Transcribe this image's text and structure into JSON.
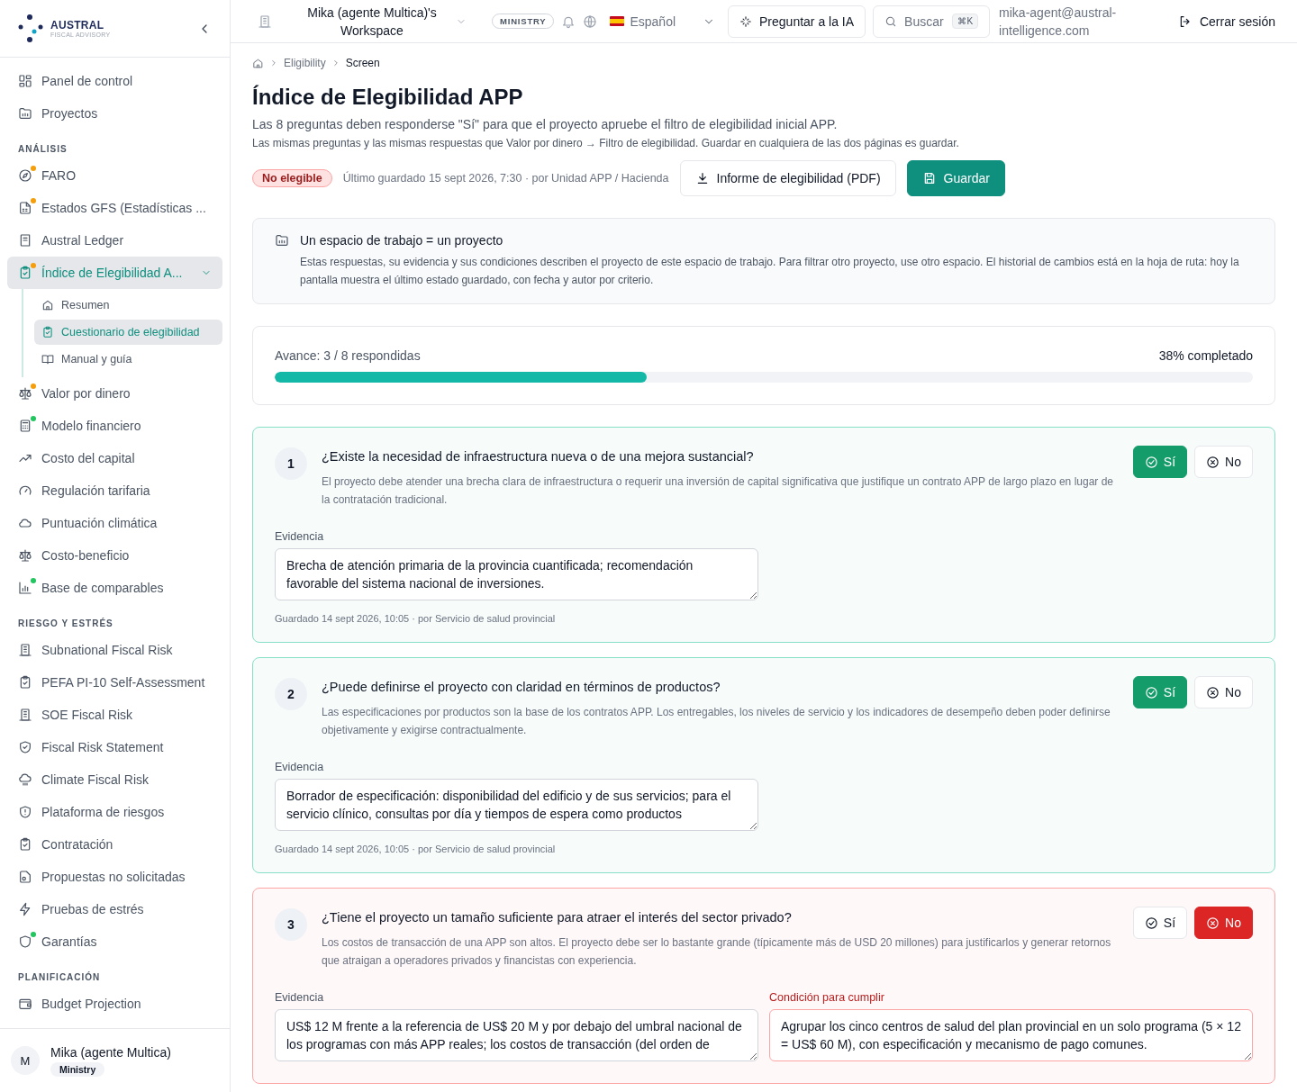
{
  "sidebar": {
    "logo": {
      "name": "AUSTRAL",
      "tagline": "FISCAL ADVISORY"
    },
    "groups": [
      {
        "items": [
          {
            "label": "Panel de control",
            "selected": false
          },
          {
            "label": "Proyectos",
            "selected": false
          }
        ]
      },
      {
        "heading": "ANÁLISIS",
        "items": [
          {
            "label": "FARO",
            "selected": false,
            "color": "#f59e0b"
          },
          {
            "label": "Estados GFS (Estadísticas ...",
            "selected": false,
            "color": "#f59e0b"
          },
          {
            "label": "Austral Ledger",
            "selected": false
          },
          {
            "label": "Índice de Elegibilidad A...",
            "selected": true,
            "expanded": true,
            "color": "#f59e0b",
            "children": [
              {
                "label": "Resumen",
                "selected": false
              },
              {
                "label": "Cuestionario de elegibilidad",
                "selected": true
              },
              {
                "label": "Manual y guía",
                "selected": false
              }
            ]
          },
          {
            "label": "Valor por dinero",
            "selected": false,
            "color": "#f59e0b"
          },
          {
            "label": "Modelo financiero",
            "selected": false,
            "color": "#22c55e"
          },
          {
            "label": "Costo del capital",
            "selected": false
          },
          {
            "label": "Regulación tarifaria",
            "selected": false
          },
          {
            "label": "Puntuación climática",
            "selected": false
          },
          {
            "label": "Costo-beneficio",
            "selected": false
          },
          {
            "label": "Base de comparables",
            "selected": false,
            "color": "#22c55e"
          }
        ]
      },
      {
        "heading": "RIESGO Y ESTRÉS",
        "items": [
          {
            "label": "Subnational Fiscal Risk",
            "selected": false
          },
          {
            "label": "PEFA PI-10 Self-Assessment",
            "selected": false
          },
          {
            "label": "SOE Fiscal Risk",
            "selected": false
          },
          {
            "label": "Fiscal Risk Statement",
            "selected": false
          },
          {
            "label": "Climate Fiscal Risk",
            "selected": false
          },
          {
            "label": "Plataforma de riesgos",
            "selected": false
          },
          {
            "label": "Contratación",
            "selected": false
          },
          {
            "label": "Propuestas no solicitadas",
            "selected": false
          },
          {
            "label": "Pruebas de estrés",
            "selected": false
          },
          {
            "label": "Garantías",
            "selected": false,
            "color": "#22c55e"
          }
        ]
      },
      {
        "heading": "PLANIFICACIÓN",
        "items": [
          {
            "label": "Budget Projection",
            "selected": false
          }
        ]
      }
    ],
    "user": {
      "initial": "M",
      "name": "Mika (agente Multica)",
      "role": "Ministry"
    }
  },
  "topbar": {
    "workspace": "Mika (agente Multica)'s Workspace",
    "badge": "MINISTRY",
    "language": "Español",
    "ask_ai": "Preguntar a la IA",
    "search": {
      "placeholder": "Buscar",
      "shortcut": "⌘K"
    },
    "email": "mika-agent@austral-intelligence.com",
    "logout": "Cerrar sesión"
  },
  "breadcrumb": [
    "Eligibility",
    "Screen"
  ],
  "title": "Índice de Elegibilidad APP",
  "subtitle": "Las 8 preguntas deben responderse \"Sí\" para que el proyecto apruebe el filtro de elegibilidad inicial APP.",
  "note": "Las mismas preguntas y las mismas respuestas que Valor por dinero → Filtro de elegibilidad. Guardar en cualquiera de las dos páginas es guardar.",
  "status": {
    "label": "No elegible",
    "last_saved": "Último guardado 15 sept 2026, 7:30 · por Unidad APP / Hacienda"
  },
  "actions": {
    "report": "Informe de elegibilidad (PDF)",
    "save": "Guardar"
  },
  "info": {
    "title": "Un espacio de trabajo = un proyecto",
    "text": "Estas respuestas, su evidencia y sus condiciones describen el proyecto de este espacio de trabajo. Para filtrar otro proyecto, use otro espacio. El historial de cambios está en la hoja de ruta: hoy la pantalla muestra el último estado guardado, con fecha y autor por criterio."
  },
  "progress": {
    "label": "Avance: 3 / 8 respondidas",
    "percent": "38% completado",
    "level": 0.38
  },
  "questions": [
    {
      "number": "1",
      "title": "¿Existe la necesidad de infraestructura nueva o de una mejora sustancial?",
      "description": "El proyecto debe atender una brecha clara de infraestructura o requerir una inversión de capital significativa que justifique un contrato APP de largo plazo en lugar de la contratación tradicional.",
      "options": [
        {
          "kind": "yes",
          "label": "Sí",
          "selected": true
        },
        {
          "kind": "no",
          "label": "No",
          "selected": false
        }
      ],
      "evidence_label": "Evidencia",
      "evidence": "Brecha de atención primaria de la provincia cuantificada; recomendación favorable del sistema nacional de inversiones.",
      "saved": "Guardado 14 sept 2026, 10:05 · por Servicio de salud provincial"
    },
    {
      "number": "2",
      "title": "¿Puede definirse el proyecto con claridad en términos de productos?",
      "description": "Las especificaciones por productos son la base de los contratos APP. Los entregables, los niveles de servicio y los indicadores de desempeño deben poder definirse objetivamente y exigirse contractualmente.",
      "options": [
        {
          "kind": "yes",
          "label": "Sí",
          "selected": true
        },
        {
          "kind": "no",
          "label": "No",
          "selected": false
        }
      ],
      "evidence_label": "Evidencia",
      "evidence": "Borrador de especificación: disponibilidad del edificio y de sus servicios; para el servicio clínico, consultas por día y tiempos de espera como productos",
      "saved": "Guardado 14 sept 2026, 10:05 · por Servicio de salud provincial"
    },
    {
      "number": "3",
      "title": "¿Tiene el proyecto un tamaño suficiente para atraer el interés del sector privado?",
      "description": "Los costos de transacción de una APP son altos. El proyecto debe ser lo bastante grande (típicamente más de USD 20 millones) para justificarlos y generar retornos que atraigan a operadores privados y financistas con experiencia.",
      "options": [
        {
          "kind": "yes",
          "label": "Sí",
          "selected": false
        },
        {
          "kind": "no",
          "label": "No",
          "selected": true
        }
      ],
      "evidence_label": "Evidencia",
      "evidence": "US$ 12 M frente a la referencia de US$ 20 M y por debajo del umbral nacional de los programas con más APP reales; los costos de transacción (del orden de",
      "condition_label": "Condición para cumplir",
      "condition": "Agrupar los cinco centros de salud del plan provincial en un solo programa (5 × 12 = US$ 60 M), con especificación y mecanismo de pago comunes."
    }
  ]
}
